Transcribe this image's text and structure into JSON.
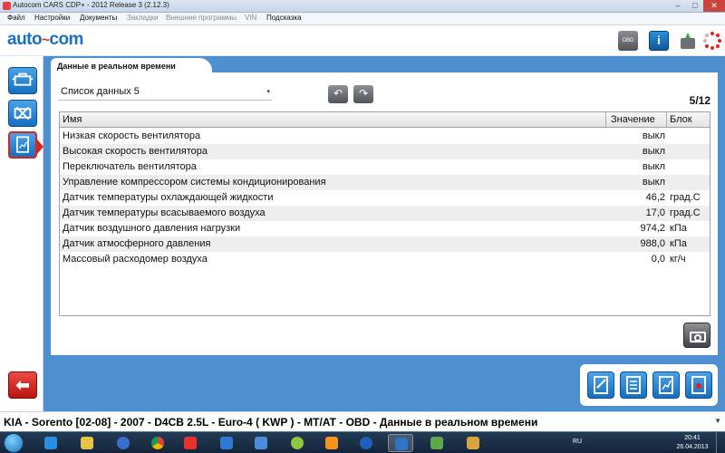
{
  "window": {
    "title": "Autocom CARS CDP+ - 2012 Release 3 (2.12.3)",
    "minimize_glyph": "–",
    "maximize_glyph": "□",
    "close_glyph": "✕"
  },
  "menu": {
    "items": [
      {
        "label": "Файл"
      },
      {
        "label": "Настройки"
      },
      {
        "label": "Документы"
      },
      {
        "label": "Закладки"
      },
      {
        "label": "Внешние программы"
      },
      {
        "label": "VIN"
      },
      {
        "label": "Подсказка"
      }
    ]
  },
  "logo": {
    "left": "auto",
    "mid": "~",
    "right": "com"
  },
  "toolbar": {
    "obd_label": "OBD",
    "help_label": "i"
  },
  "tab": {
    "label": "Данные в реальном времени"
  },
  "data_list": {
    "selected": "Список данных 5",
    "caret": "▾",
    "prev_glyph": "↶",
    "next_glyph": "↷",
    "page": "5/12"
  },
  "table": {
    "headers": {
      "name": "Имя",
      "value": "Значение",
      "unit": "Блок"
    },
    "rows": [
      {
        "name": "Низкая скорость вентилятора",
        "value": "выкл",
        "unit": ""
      },
      {
        "name": "Высокая скорость вентилятора",
        "value": "выкл",
        "unit": ""
      },
      {
        "name": "Переключатель вентилятора",
        "value": "выкл",
        "unit": ""
      },
      {
        "name": "Управление компрессором системы кондиционирования",
        "value": "выкл",
        "unit": ""
      },
      {
        "name": "Датчик температуры охлаждающей жидкости",
        "value": "46,2",
        "unit": "град.С"
      },
      {
        "name": "Датчик температуры всасываемого воздуха",
        "value": "17,0",
        "unit": "град.С"
      },
      {
        "name": "Датчик воздушного давления нагрузки",
        "value": "974,2",
        "unit": "кПа"
      },
      {
        "name": "Датчик атмосферного давления",
        "value": "988,0",
        "unit": "кПа"
      },
      {
        "name": "Массовый расходомер воздуха",
        "value": "0,0",
        "unit": "кг/ч"
      }
    ]
  },
  "sidebar": {
    "back_glyph": "⬅"
  },
  "status": {
    "text": "KIA - Sorento [02-08] - 2007 - D4CB 2.5L - Euro-4 ( KWP ) - MT/AT - OBD - Данные в реальном времени",
    "expand_glyph": "▼"
  },
  "taskbar": {
    "lang": "RU",
    "time": "20:41",
    "date": "26.04.2013"
  }
}
